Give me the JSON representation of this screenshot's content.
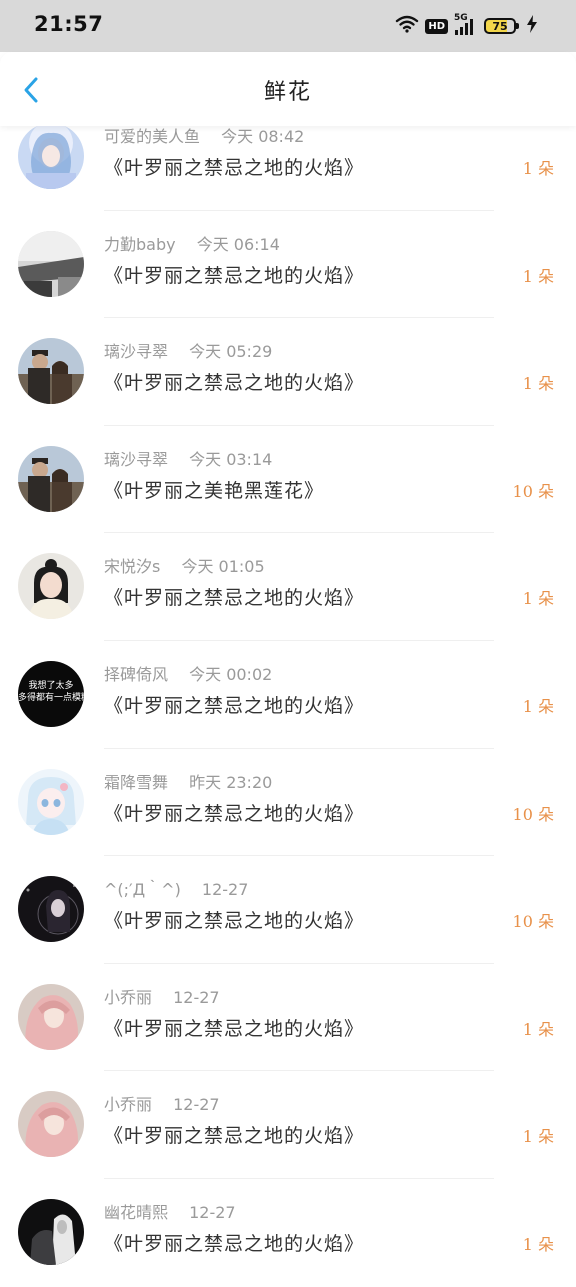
{
  "status_bar": {
    "time": "21:57",
    "hd": "HD",
    "network": "5G",
    "battery": "75",
    "icons": [
      "wifi-icon",
      "signal-icon",
      "battery-icon",
      "charging-icon"
    ]
  },
  "header": {
    "title": "鲜花",
    "back_icon": "chevron-left-icon",
    "accent_color": "#2aa3e6"
  },
  "records": [
    {
      "name": "可爱的美人鱼",
      "time": "今天 08:42",
      "gift": "《叶罗丽之禁忌之地的火焰》",
      "count": "1 朵",
      "avatar": "avatar-mermaid"
    },
    {
      "name": "力勤baby",
      "time": "今天 06:14",
      "gift": "《叶罗丽之禁忌之地的火焰》",
      "count": "1 朵",
      "avatar": "avatar-grayscale-car"
    },
    {
      "name": "璃沙寻翠",
      "time": "今天 05:29",
      "gift": "《叶罗丽之禁忌之地的火焰》",
      "count": "1 朵",
      "avatar": "avatar-couple"
    },
    {
      "name": "璃沙寻翠",
      "time": "今天 03:14",
      "gift": "《叶罗丽之美艳黑莲花》",
      "count": "10 朵",
      "avatar": "avatar-couple"
    },
    {
      "name": "宋悦汐s",
      "time": "今天 01:05",
      "gift": "《叶罗丽之禁忌之地的火焰》",
      "count": "1 朵",
      "avatar": "avatar-girl"
    },
    {
      "name": "择碑倚风",
      "time": "今天 00:02",
      "gift": "《叶罗丽之禁忌之地的火焰》",
      "count": "1 朵",
      "avatar": "avatar-text-black",
      "avatar_text": [
        "我想了太多",
        "多得都有一点模糊"
      ]
    },
    {
      "name": "霜降雪舞",
      "time": "昨天 23:20",
      "gift": "《叶罗丽之禁忌之地的火焰》",
      "count": "10 朵",
      "avatar": "avatar-anime-doll"
    },
    {
      "name": "^(;′Д｀^)",
      "time": "12-27",
      "gift": "《叶罗丽之禁忌之地的火焰》",
      "count": "10 朵",
      "avatar": "avatar-dark-girl"
    },
    {
      "name": "小乔丽",
      "time": "12-27",
      "gift": "《叶罗丽之禁忌之地的火焰》",
      "count": "1 朵",
      "avatar": "avatar-pink-hair"
    },
    {
      "name": "小乔丽",
      "time": "12-27",
      "gift": "《叶罗丽之禁忌之地的火焰》",
      "count": "1 朵",
      "avatar": "avatar-pink-hair"
    },
    {
      "name": "幽花晴熙",
      "time": "12-27",
      "gift": "《叶罗丽之禁忌之地的火焰》",
      "count": "1 朵",
      "avatar": "avatar-dark-figure"
    }
  ],
  "colors": {
    "count_color": "#e8914a",
    "meta_color": "#9a9a9a",
    "status_bar_bg": "#d9d9d9"
  }
}
